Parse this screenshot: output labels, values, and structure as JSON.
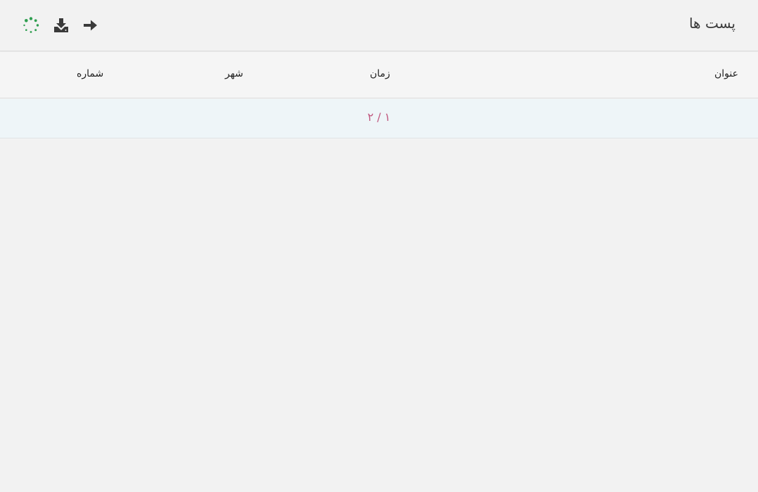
{
  "header": {
    "title": "پست ها",
    "back_icon": "arrow-right-icon",
    "download_icon": "download-icon",
    "loading_icon": "spinner-icon"
  },
  "table": {
    "columns": [
      {
        "key": "title",
        "label": "عنوان"
      },
      {
        "key": "time",
        "label": "زمان"
      },
      {
        "key": "city",
        "label": "شهر"
      },
      {
        "key": "number",
        "label": "شماره"
      }
    ],
    "pagination": "۱ / ۲"
  },
  "colors": {
    "background": "#f2f2f2",
    "header_row": "#f5f5f5",
    "pager_row": "#eef5f8",
    "pager_text": "#c0587f",
    "spinner": "#2e9e4f",
    "icons": "#3a3a3a"
  }
}
